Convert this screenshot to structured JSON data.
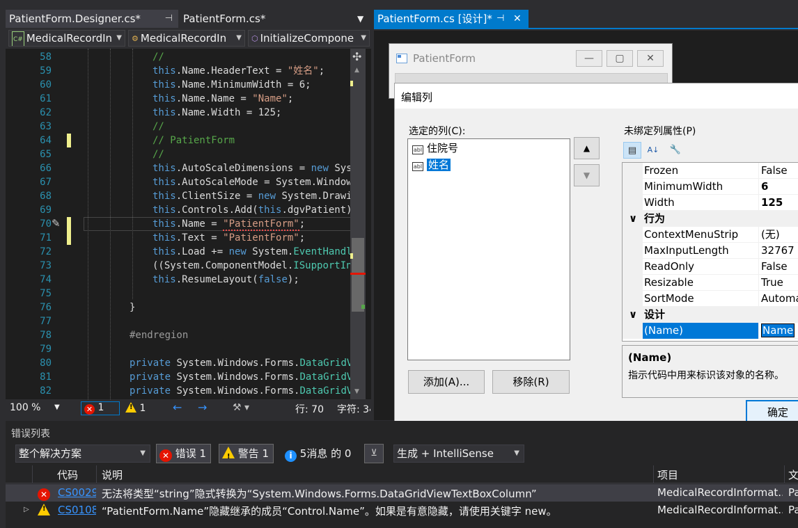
{
  "tabs_left": [
    {
      "label": "PatientForm.Designer.cs*",
      "pin": "⊣",
      "active": true
    },
    {
      "label": "PatientForm.cs*",
      "active": false
    }
  ],
  "tab_dropdown": "▼",
  "tabs_right": [
    {
      "label": "PatientForm.cs [设计]*",
      "pin": "⊣",
      "close": "✕"
    }
  ],
  "navbar": {
    "project": "MedicalRecordIn",
    "class": "MedicalRecordIn",
    "member": "InitializeCompone"
  },
  "code": {
    "lines": [
      {
        "n": "58",
        "parts": [
          [
            "cm",
            "//"
          ]
        ]
      },
      {
        "n": "59",
        "parts": [
          [
            "kw",
            "this"
          ],
          [
            "tx",
            ".Name.HeaderText = "
          ],
          [
            "st",
            "\"姓名\""
          ],
          [
            "tx",
            ";"
          ]
        ]
      },
      {
        "n": "60",
        "parts": [
          [
            "kw",
            "this"
          ],
          [
            "tx",
            ".Name.MinimumWidth = 6;"
          ]
        ]
      },
      {
        "n": "61",
        "parts": [
          [
            "kw",
            "this"
          ],
          [
            "tx",
            ".Name.Name = "
          ],
          [
            "st",
            "\"Name\""
          ],
          [
            "tx",
            ";"
          ]
        ]
      },
      {
        "n": "62",
        "parts": [
          [
            "kw",
            "this"
          ],
          [
            "tx",
            ".Name.Width = 125;"
          ]
        ]
      },
      {
        "n": "63",
        "parts": [
          [
            "cm",
            "//"
          ]
        ]
      },
      {
        "n": "64",
        "parts": [
          [
            "cm",
            "// PatientForm"
          ]
        ]
      },
      {
        "n": "65",
        "parts": [
          [
            "cm",
            "//"
          ]
        ]
      },
      {
        "n": "66",
        "parts": [
          [
            "kw",
            "this"
          ],
          [
            "tx",
            ".AutoScaleDimensions = "
          ],
          [
            "kw",
            "new"
          ],
          [
            "tx",
            " Syst"
          ]
        ]
      },
      {
        "n": "67",
        "parts": [
          [
            "kw",
            "this"
          ],
          [
            "tx",
            ".AutoScaleMode = System.Windows"
          ]
        ]
      },
      {
        "n": "68",
        "parts": [
          [
            "kw",
            "this"
          ],
          [
            "tx",
            ".ClientSize = "
          ],
          [
            "kw",
            "new"
          ],
          [
            "tx",
            " System.Drawin"
          ]
        ]
      },
      {
        "n": "69",
        "parts": [
          [
            "kw",
            "this"
          ],
          [
            "tx",
            ".Controls.Add("
          ],
          [
            "kw",
            "this"
          ],
          [
            "tx",
            ".dgvPatient);"
          ]
        ]
      },
      {
        "n": "70",
        "parts": [
          [
            "kw",
            "this"
          ],
          [
            "tx",
            ".Name = "
          ],
          [
            "sq",
            "\"PatientForm\""
          ],
          [
            "tx",
            ";"
          ]
        ]
      },
      {
        "n": "71",
        "parts": [
          [
            "kw",
            "this"
          ],
          [
            "tx",
            ".Text = "
          ],
          [
            "st",
            "\"PatientForm\""
          ],
          [
            "tx",
            ";"
          ]
        ]
      },
      {
        "n": "72",
        "parts": [
          [
            "kw",
            "this"
          ],
          [
            "tx",
            ".Load += "
          ],
          [
            "kw",
            "new"
          ],
          [
            "tx",
            " System."
          ],
          [
            "ty",
            "EventHandle"
          ]
        ]
      },
      {
        "n": "73",
        "parts": [
          [
            "tx",
            "((System.ComponentModel."
          ],
          [
            "ty",
            "ISupportIni"
          ]
        ]
      },
      {
        "n": "74",
        "parts": [
          [
            "kw",
            "this"
          ],
          [
            "tx",
            ".ResumeLayout("
          ],
          [
            "kw",
            "false"
          ],
          [
            "tx",
            ");"
          ]
        ]
      },
      {
        "n": "75",
        "parts": []
      },
      {
        "n": "76",
        "parts": [
          [
            "tx",
            "}"
          ]
        ]
      },
      {
        "n": "77",
        "parts": []
      },
      {
        "n": "78",
        "parts": [
          [
            "pp",
            "#endregion"
          ]
        ]
      },
      {
        "n": "79",
        "parts": []
      },
      {
        "n": "80",
        "parts": [
          [
            "kw",
            "private"
          ],
          [
            "tx",
            " System.Windows.Forms."
          ],
          [
            "ty",
            "DataGridVi"
          ]
        ]
      },
      {
        "n": "81",
        "parts": [
          [
            "kw",
            "private"
          ],
          [
            "tx",
            " System.Windows.Forms."
          ],
          [
            "ty",
            "DataGridVi"
          ]
        ]
      },
      {
        "n": "82",
        "parts": [
          [
            "kw",
            "private"
          ],
          [
            "tx",
            " System.Windows.Forms."
          ],
          [
            "ty",
            "DataGridVi"
          ]
        ]
      }
    ]
  },
  "editor_status": {
    "zoom": "100 %",
    "errors": "1",
    "warnings": "1",
    "line": "行: 70",
    "char": "字符: 34"
  },
  "patient_form": {
    "title": "PatientForm",
    "min": "—",
    "max": "▢",
    "close": "✕"
  },
  "dialog": {
    "title": "编辑列",
    "selected_columns_label": "选定的列(C):",
    "columns": [
      {
        "label": "住院号",
        "selected": false
      },
      {
        "label": "姓名",
        "selected": true
      }
    ],
    "up": "▲",
    "down": "▼",
    "add_button": "添加(A)...",
    "remove_button": "移除(R)",
    "props_label": "未绑定列属性(P)",
    "properties": [
      {
        "kind": "prop",
        "name": "Frozen",
        "value": "False",
        "bold": false
      },
      {
        "kind": "prop",
        "name": "MinimumWidth",
        "value": "6",
        "bold": true
      },
      {
        "kind": "prop",
        "name": "Width",
        "value": "125",
        "bold": true
      },
      {
        "kind": "cat",
        "name": "行为"
      },
      {
        "kind": "prop",
        "name": "ContextMenuStrip",
        "value": "(无)",
        "bold": false
      },
      {
        "kind": "prop",
        "name": "MaxInputLength",
        "value": "32767",
        "bold": false
      },
      {
        "kind": "prop",
        "name": "ReadOnly",
        "value": "False",
        "bold": false
      },
      {
        "kind": "prop",
        "name": "Resizable",
        "value": "True",
        "bold": false
      },
      {
        "kind": "prop",
        "name": "SortMode",
        "value": "Automa",
        "bold": false
      },
      {
        "kind": "cat",
        "name": "设计"
      },
      {
        "kind": "prop",
        "name": "(Name)",
        "value": "Name",
        "bold": false,
        "selected": true
      }
    ],
    "desc_title": "(Name)",
    "desc_text": "指示代码中用来标识该对象的名称。",
    "ok_button": "确定"
  },
  "error_list": {
    "title": "错误列表",
    "scope": "整个解决方案",
    "errors_btn": "错误 1",
    "warnings_btn": "警告 1",
    "messages_btn": "5消息 的 0",
    "build_filter": "生成 + IntelliSense",
    "headers": {
      "code": "代码",
      "desc": "说明",
      "project": "项目",
      "file": "文"
    },
    "rows": [
      {
        "type": "error",
        "code": "CS0029",
        "desc": "无法将类型“string”隐式转换为“System.Windows.Forms.DataGridViewTextBoxColumn”",
        "project": "MedicalRecordInformat...",
        "file": "Pa"
      },
      {
        "type": "warning",
        "code": "CS0108",
        "desc": "“PatientForm.Name”隐藏继承的成员“Control.Name”。如果是有意隐藏，请使用关键字 new。",
        "project": "MedicalRecordInformat...",
        "file": "Pa"
      }
    ]
  },
  "colors": {
    "accent": "#007acc",
    "editor_bg": "#1e1e1e",
    "keyword": "#569cd6",
    "comment": "#57a64a",
    "string": "#d69d85",
    "type": "#4ec9b0",
    "error": "#e51400",
    "warning": "#ffcc00",
    "selection": "#0078d7"
  }
}
